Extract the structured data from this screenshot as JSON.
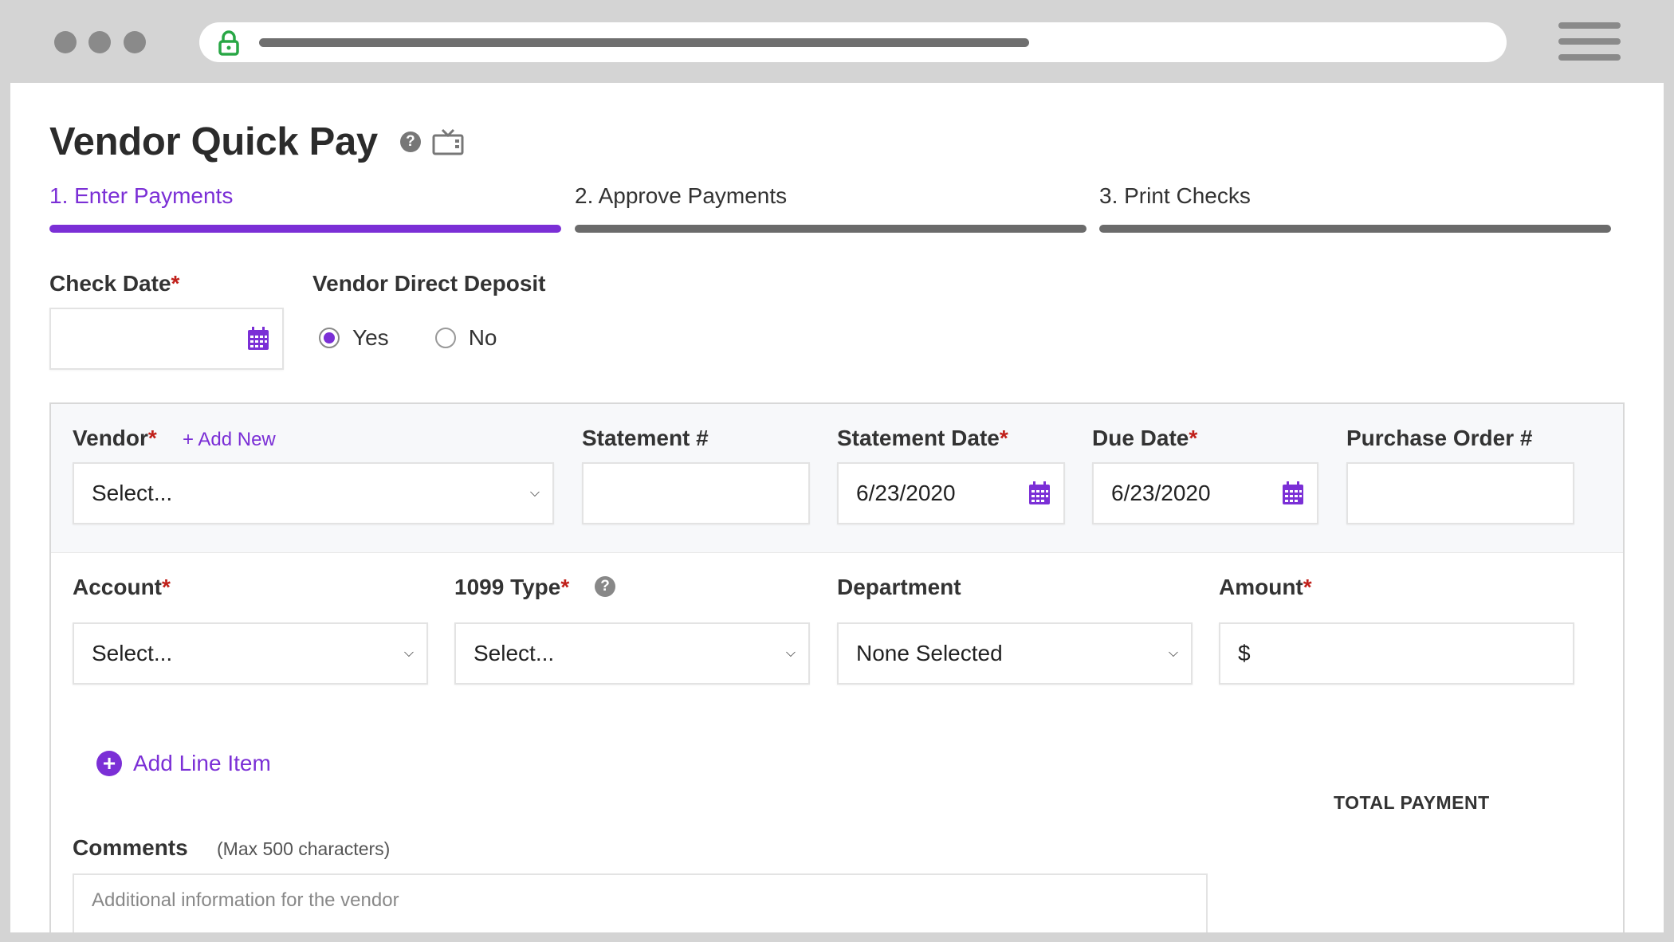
{
  "page": {
    "title": "Vendor Quick Pay",
    "help_icon": "help-circle-icon",
    "video_icon": "tv-icon"
  },
  "steps": [
    {
      "label": "1. Enter Payments",
      "active": true
    },
    {
      "label": "2. Approve Payments",
      "active": false
    },
    {
      "label": "3. Print Checks",
      "active": false
    }
  ],
  "check_date": {
    "label": "Check Date",
    "required_mark": "*",
    "value": ""
  },
  "direct_deposit": {
    "label": "Vendor Direct Deposit",
    "options": [
      {
        "label": "Yes",
        "selected": true
      },
      {
        "label": "No",
        "selected": false
      }
    ]
  },
  "statement": {
    "vendor": {
      "label": "Vendor",
      "required_mark": "*",
      "add_new": "+ Add New",
      "value": "Select..."
    },
    "statement_no": {
      "label": "Statement #",
      "value": ""
    },
    "statement_date": {
      "label": "Statement Date",
      "required_mark": "*",
      "value": "6/23/2020"
    },
    "due_date": {
      "label": "Due Date",
      "required_mark": "*",
      "value": "6/23/2020"
    },
    "po_no": {
      "label": "Purchase Order #",
      "value": ""
    }
  },
  "line_item": {
    "account": {
      "label": "Account",
      "required_mark": "*",
      "value": "Select..."
    },
    "type_1099": {
      "label": "1099 Type",
      "required_mark": "*",
      "value": "Select..."
    },
    "department": {
      "label": "Department",
      "value": "None Selected"
    },
    "amount": {
      "label": "Amount",
      "required_mark": "*",
      "prefix": "$",
      "value": ""
    }
  },
  "add_line_item": {
    "label": "Add Line Item"
  },
  "total_payment": {
    "label": "TOTAL PAYMENT"
  },
  "comments": {
    "label": "Comments",
    "hint": "(Max 500 characters)",
    "placeholder": "Additional information for the vendor"
  },
  "colors": {
    "accent": "#7b2fd6",
    "required": "#c0201a"
  }
}
